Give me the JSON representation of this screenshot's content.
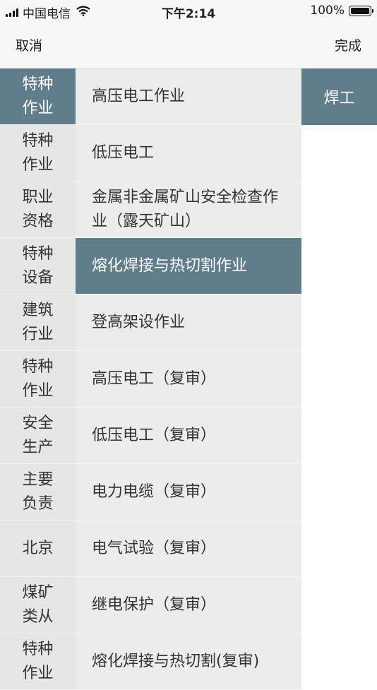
{
  "status_bar": {
    "carrier": "中国电信",
    "time": "下午2:14",
    "battery": "100%"
  },
  "nav": {
    "cancel": "取消",
    "done": "完成"
  },
  "column1": [
    {
      "label": "特种作业",
      "selected": true
    },
    {
      "label": "特种作业",
      "selected": false
    },
    {
      "label": "职业资格",
      "selected": false
    },
    {
      "label": "特种设备",
      "selected": false
    },
    {
      "label": "建筑行业",
      "selected": false
    },
    {
      "label": "特种作业",
      "selected": false
    },
    {
      "label": "安全生产",
      "selected": false
    },
    {
      "label": "主要负责",
      "selected": false
    },
    {
      "label": "北京",
      "selected": false
    },
    {
      "label": "煤矿类从",
      "selected": false
    },
    {
      "label": "特种作业",
      "selected": false
    }
  ],
  "column2": [
    {
      "label": "高压电工作业",
      "selected": false
    },
    {
      "label": "低压电工",
      "selected": false
    },
    {
      "label": "金属非金属矿山安全检查作业（露天矿山）",
      "selected": false
    },
    {
      "label": "熔化焊接与热切割作业",
      "selected": true
    },
    {
      "label": "登高架设作业",
      "selected": false
    },
    {
      "label": "高压电工（复审）",
      "selected": false
    },
    {
      "label": "低压电工（复审）",
      "selected": false
    },
    {
      "label": "电力电缆（复审）",
      "selected": false
    },
    {
      "label": "电气试验（复审）",
      "selected": false
    },
    {
      "label": "继电保护（复审）",
      "selected": false
    },
    {
      "label": "熔化焊接与热切割(复审)",
      "selected": false
    }
  ],
  "column3": [
    {
      "label": "焊工",
      "selected": true
    }
  ],
  "colors": {
    "selected": "#607d8b",
    "col1_bg": "#e6e6e6",
    "col2_bg": "#ececec"
  }
}
